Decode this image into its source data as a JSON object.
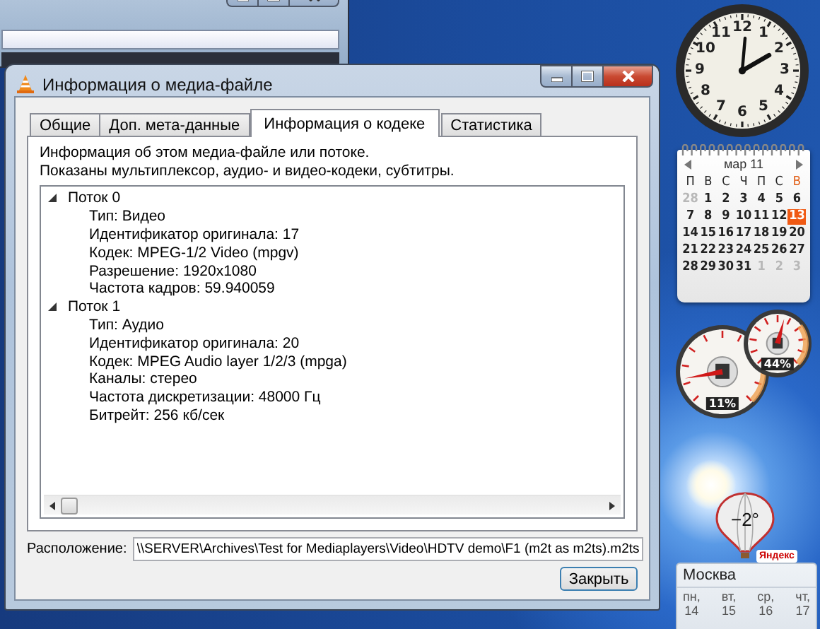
{
  "dialog": {
    "title": "Информация о медиа-файле",
    "tabs": [
      {
        "label": "Общие",
        "selected": false
      },
      {
        "label": "Доп. мета-данные",
        "selected": false
      },
      {
        "label": "Информация о кодеке",
        "selected": true
      },
      {
        "label": "Статистика",
        "selected": false
      }
    ],
    "description": [
      "Информация об этом медиа-файле или потоке.",
      "Показаны мультиплексор, аудио- и видео-кодеки, субтитры."
    ],
    "tree": [
      {
        "label": "Поток 0",
        "expanded": true,
        "children": [
          {
            "label": "Тип: Видео"
          },
          {
            "label": "Идентификатор оригинала: 17"
          },
          {
            "label": "Кодек: MPEG-1/2 Video (mpgv)"
          },
          {
            "label": "Разрешение: 1920x1080"
          },
          {
            "label": "Частота кадров: 59.940059"
          }
        ]
      },
      {
        "label": "Поток 1",
        "expanded": true,
        "children": [
          {
            "label": "Тип: Аудио"
          },
          {
            "label": "Идентификатор оригинала: 20"
          },
          {
            "label": "Кодек: MPEG Audio layer 1/2/3 (mpga)"
          },
          {
            "label": "Каналы: стерео"
          },
          {
            "label": "Частота дискретизации: 48000 Гц"
          },
          {
            "label": "Битрейт: 256 кб/сек"
          }
        ]
      }
    ],
    "location": {
      "label": "Расположение:",
      "value": "\\\\SERVER\\Archives\\Test for Mediaplayers\\Video\\HDTV demo\\F1 (m2t as m2ts).m2ts"
    },
    "close_button": "Закрыть"
  },
  "clock": {
    "numerals": [
      "12",
      "11",
      "1",
      "10",
      "2",
      "9",
      "3",
      "8",
      "4",
      "7",
      "5",
      "6"
    ]
  },
  "calendar": {
    "month": "мар 11",
    "weekdays": [
      {
        "label": "П",
        "weekend": false
      },
      {
        "label": "В",
        "weekend": false
      },
      {
        "label": "С",
        "weekend": false
      },
      {
        "label": "Ч",
        "weekend": false
      },
      {
        "label": "П",
        "weekend": false
      },
      {
        "label": "С",
        "weekend": false
      },
      {
        "label": "В",
        "weekend": true
      }
    ],
    "days": [
      {
        "label": "28",
        "muted": true,
        "selected": false
      },
      {
        "label": "1",
        "muted": false,
        "selected": false
      },
      {
        "label": "2",
        "muted": false,
        "selected": false
      },
      {
        "label": "3",
        "muted": false,
        "selected": false
      },
      {
        "label": "4",
        "muted": false,
        "selected": false
      },
      {
        "label": "5",
        "muted": false,
        "selected": false
      },
      {
        "label": "6",
        "muted": false,
        "selected": false
      },
      {
        "label": "7",
        "muted": false,
        "selected": false
      },
      {
        "label": "8",
        "muted": false,
        "selected": false
      },
      {
        "label": "9",
        "muted": false,
        "selected": false
      },
      {
        "label": "10",
        "muted": false,
        "selected": false
      },
      {
        "label": "11",
        "muted": false,
        "selected": false
      },
      {
        "label": "12",
        "muted": false,
        "selected": false
      },
      {
        "label": "13",
        "muted": false,
        "selected": true
      },
      {
        "label": "14",
        "muted": false,
        "selected": false
      },
      {
        "label": "15",
        "muted": false,
        "selected": false
      },
      {
        "label": "16",
        "muted": false,
        "selected": false
      },
      {
        "label": "17",
        "muted": false,
        "selected": false
      },
      {
        "label": "18",
        "muted": false,
        "selected": false
      },
      {
        "label": "19",
        "muted": false,
        "selected": false
      },
      {
        "label": "20",
        "muted": false,
        "selected": false
      },
      {
        "label": "21",
        "muted": false,
        "selected": false
      },
      {
        "label": "22",
        "muted": false,
        "selected": false
      },
      {
        "label": "23",
        "muted": false,
        "selected": false
      },
      {
        "label": "24",
        "muted": false,
        "selected": false
      },
      {
        "label": "25",
        "muted": false,
        "selected": false
      },
      {
        "label": "26",
        "muted": false,
        "selected": false
      },
      {
        "label": "27",
        "muted": false,
        "selected": false
      },
      {
        "label": "28",
        "muted": false,
        "selected": false
      },
      {
        "label": "29",
        "muted": false,
        "selected": false
      },
      {
        "label": "30",
        "muted": false,
        "selected": false
      },
      {
        "label": "31",
        "muted": false,
        "selected": false
      },
      {
        "label": "1",
        "muted": true,
        "selected": false
      },
      {
        "label": "2",
        "muted": true,
        "selected": false
      },
      {
        "label": "3",
        "muted": true,
        "selected": false
      }
    ]
  },
  "gauges": [
    {
      "reading": "11%"
    },
    {
      "reading": "44%"
    }
  ],
  "weather": {
    "temperature": "−2°",
    "provider": "Яндекс",
    "city": "Москва",
    "days": [
      {
        "day": "пн,",
        "date": "14"
      },
      {
        "day": "вт,",
        "date": "15"
      },
      {
        "day": "ср,",
        "date": "16"
      },
      {
        "day": "чт,",
        "date": "17"
      }
    ]
  }
}
